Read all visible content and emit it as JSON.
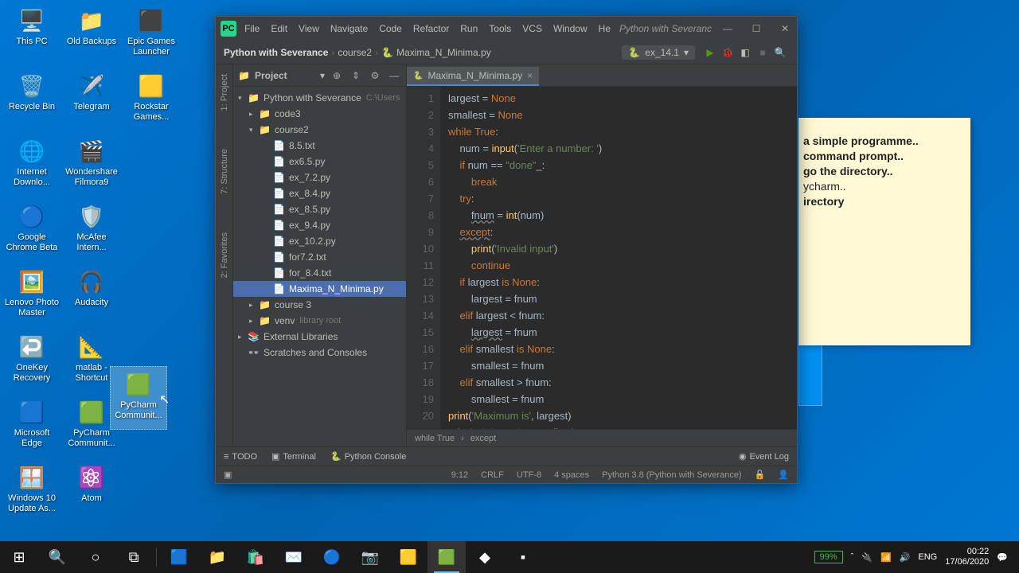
{
  "desktop": {
    "col1": [
      {
        "label": "This PC",
        "glyph": "🖥️"
      },
      {
        "label": "Recycle Bin",
        "glyph": "🗑️"
      },
      {
        "label": "Internet Downlo...",
        "glyph": "🌐"
      },
      {
        "label": "Google Chrome Beta",
        "glyph": "🔵"
      },
      {
        "label": "Lenovo Photo Master",
        "glyph": "🖼️"
      },
      {
        "label": "OneKey Recovery",
        "glyph": "↩️"
      },
      {
        "label": "Microsoft Edge",
        "glyph": "🟦"
      },
      {
        "label": "Windows 10 Update As...",
        "glyph": "🪟"
      }
    ],
    "col2": [
      {
        "label": "Old Backups",
        "glyph": "📁"
      },
      {
        "label": "Telegram",
        "glyph": "✈️"
      },
      {
        "label": "Wondershare Filmora9",
        "glyph": "🎬"
      },
      {
        "label": "McAfee Intern...",
        "glyph": "🛡️"
      },
      {
        "label": "Audacity",
        "glyph": "🎧"
      },
      {
        "label": "matlab - Shortcut",
        "glyph": "📐"
      },
      {
        "label": "PyCharm Communit...",
        "glyph": "🟩"
      },
      {
        "label": "Atom",
        "glyph": "⚛️"
      }
    ],
    "col3": [
      {
        "label": "Epic Games Launcher",
        "glyph": "⬛"
      },
      {
        "label": "Rockstar Games...",
        "glyph": "🟨"
      }
    ],
    "drag": {
      "label": "PyCharm Communit...",
      "glyph": "🟩"
    }
  },
  "ide": {
    "menu": [
      "File",
      "Edit",
      "View",
      "Navigate",
      "Code",
      "Refactor",
      "Run",
      "Tools",
      "VCS",
      "Window",
      "He"
    ],
    "title_hint": "Python with Severanc",
    "breadcrumb": [
      "Python with Severance",
      "course2",
      "Maxima_N_Minima.py"
    ],
    "run_config": "ex_14.1",
    "project_label": "Project",
    "gutter_labels": [
      "1: Project",
      "7: Structure",
      "2: Favorites"
    ],
    "tree": [
      {
        "indent": 0,
        "arrow": "▾",
        "icon": "📁",
        "label": "Python with Severance",
        "path": "C:\\Users",
        "sel": false
      },
      {
        "indent": 1,
        "arrow": "▸",
        "icon": "📁",
        "label": "code3",
        "sel": false
      },
      {
        "indent": 1,
        "arrow": "▾",
        "icon": "📁",
        "label": "course2",
        "sel": false
      },
      {
        "indent": 2,
        "arrow": "",
        "icon": "📄",
        "label": "8.5.txt",
        "sel": false
      },
      {
        "indent": 2,
        "arrow": "",
        "icon": "📄",
        "label": "ex6.5.py",
        "sel": false
      },
      {
        "indent": 2,
        "arrow": "",
        "icon": "📄",
        "label": "ex_7.2.py",
        "sel": false
      },
      {
        "indent": 2,
        "arrow": "",
        "icon": "📄",
        "label": "ex_8.4.py",
        "sel": false
      },
      {
        "indent": 2,
        "arrow": "",
        "icon": "📄",
        "label": "ex_8.5.py",
        "sel": false
      },
      {
        "indent": 2,
        "arrow": "",
        "icon": "📄",
        "label": "ex_9.4.py",
        "sel": false
      },
      {
        "indent": 2,
        "arrow": "",
        "icon": "📄",
        "label": "ex_10.2.py",
        "sel": false
      },
      {
        "indent": 2,
        "arrow": "",
        "icon": "📄",
        "label": "for7.2.txt",
        "sel": false
      },
      {
        "indent": 2,
        "arrow": "",
        "icon": "📄",
        "label": "for_8.4.txt",
        "sel": false
      },
      {
        "indent": 2,
        "arrow": "",
        "icon": "📄",
        "label": "Maxima_N_Minima.py",
        "sel": true
      },
      {
        "indent": 1,
        "arrow": "▸",
        "icon": "📁",
        "label": "course 3",
        "sel": false
      },
      {
        "indent": 1,
        "arrow": "▸",
        "icon": "📁",
        "label": "venv",
        "path": "library root",
        "sel": false
      },
      {
        "indent": 0,
        "arrow": "▸",
        "icon": "📚",
        "label": "External Libraries",
        "sel": false
      },
      {
        "indent": 0,
        "arrow": "",
        "icon": "👓",
        "label": "Scratches and Consoles",
        "sel": false
      }
    ],
    "tab": "Maxima_N_Minima.py",
    "code_lines": 21,
    "crumbs": [
      "while True",
      "except"
    ],
    "bottom": {
      "todo": "TODO",
      "terminal": "Terminal",
      "pycon": "Python Console",
      "eventlog": "Event Log"
    },
    "status": {
      "pos": "9:12",
      "le": "CRLF",
      "enc": "UTF-8",
      "indent": "4 spaces",
      "interp": "Python 3.8 (Python with Severance)"
    }
  },
  "sticky": {
    "l1": "a simple programme..",
    "l2": "command prompt..",
    "l3": "go the directory..",
    "l4": "ycharm..",
    "l5": "irectory"
  },
  "taskbar": {
    "battery": "99%",
    "lang": "ENG",
    "time": "00:22",
    "date": "17/06/2020"
  }
}
